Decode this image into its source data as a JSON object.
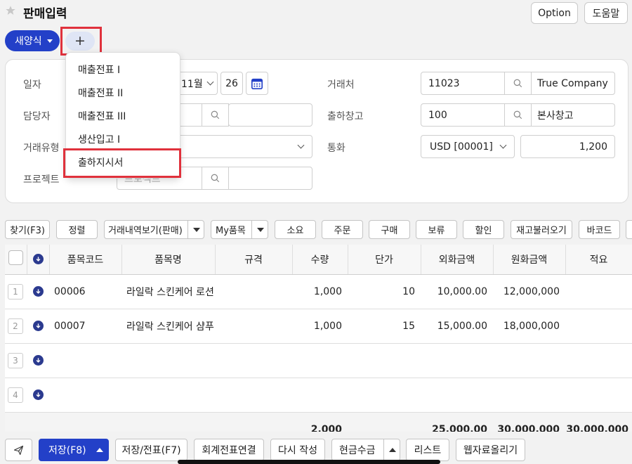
{
  "header": {
    "title": "판매입력",
    "option_label": "Option",
    "help_label": "도움말"
  },
  "template": {
    "new_form_label": "새양식",
    "add_label": "+"
  },
  "dropdown": {
    "items": [
      "매출전표 I",
      "매출전표 II",
      "매출전표 III",
      "생산입고 I",
      "출하지시서"
    ]
  },
  "form": {
    "date_label": "일자",
    "date_month": "11월",
    "date_day": "26",
    "manager_label": "담당자",
    "trade_type_label": "거래유형",
    "project_label": "프로젝트",
    "project_placeholder": "프로젝트",
    "customer_label": "거래처",
    "customer_code": "11023",
    "customer_name": "True Company",
    "warehouse_label": "출하창고",
    "warehouse_code": "100",
    "warehouse_name": "본사창고",
    "currency_label": "통화",
    "currency_value": "USD [00001]",
    "exchange_rate": "1,200"
  },
  "toolbar": {
    "find": "찾기(F3)",
    "sort": "정렬",
    "history": "거래내역보기(판매)",
    "my_items": "My품목",
    "consume": "소요",
    "order": "주문",
    "purchase": "구매",
    "hold": "보류",
    "discount": "할인",
    "stock_load": "재고불러오기",
    "barcode": "바코드"
  },
  "table": {
    "headers": [
      "품목코드",
      "품목명",
      "규격",
      "수량",
      "단가",
      "외화금액",
      "원화금액",
      "적요"
    ],
    "rows": [
      {
        "num": "1",
        "code": "00006",
        "name": "라일락 스킨케어 로션",
        "spec": "",
        "qty": "1,000",
        "price": "10",
        "foreign": "10,000.00",
        "won": "12,000,000",
        "memo": ""
      },
      {
        "num": "2",
        "code": "00007",
        "name": "라일락 스킨케어 샴푸",
        "spec": "",
        "qty": "1,000",
        "price": "15",
        "foreign": "15,000.00",
        "won": "18,000,000",
        "memo": ""
      },
      {
        "num": "3",
        "code": "",
        "name": "",
        "spec": "",
        "qty": "",
        "price": "",
        "foreign": "",
        "won": "",
        "memo": ""
      },
      {
        "num": "4",
        "code": "",
        "name": "",
        "spec": "",
        "qty": "",
        "price": "",
        "foreign": "",
        "won": "",
        "memo": ""
      }
    ],
    "totals": {
      "qty": "2,000",
      "foreign": "25,000.00",
      "won": "30,000,000",
      "won2": "30,000,000"
    }
  },
  "bottom": {
    "save": "저장(F8)",
    "save_slip": "저장/전표(F7)",
    "accounting_link": "회계전표연결",
    "rewrite": "다시 작성",
    "cash_receipt": "현금수금",
    "list": "리스트",
    "web_upload": "웹자료올리기"
  },
  "colors": {
    "primary": "#2340c8",
    "highlight": "#e0313c",
    "accent_icon": "#2b3a8f"
  }
}
